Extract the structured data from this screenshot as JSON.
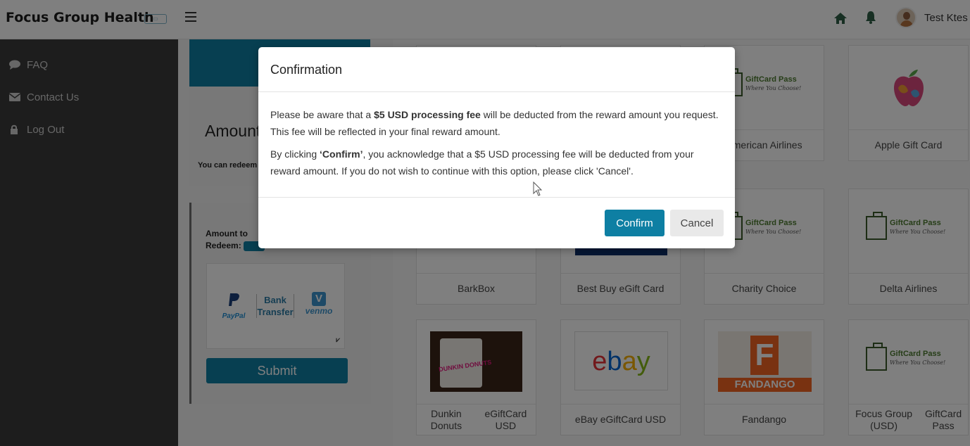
{
  "header": {
    "brand": "Focus Group Health",
    "user_name": "Test Ktes",
    "icons": [
      "menu-icon",
      "home-icon",
      "bell-icon",
      "avatar"
    ]
  },
  "sidebar": {
    "items": [
      {
        "label": "FAQ",
        "icon": "comment-icon"
      },
      {
        "label": "Contact Us",
        "icon": "envelope-icon"
      },
      {
        "label": "Log Out",
        "icon": "lock-icon"
      }
    ]
  },
  "amount": {
    "title": "Amount",
    "redeem_text": "You can redeem",
    "redeem_label_line1": "Amount to",
    "redeem_label_line2": "Redeem:",
    "payment_paypal": "PayPal",
    "payment_bank_line1": "Bank",
    "payment_bank_line2": "Transfer",
    "payment_venmo": "venmo",
    "submit_label": "Submit"
  },
  "gift_cards": [
    {
      "name": "American Airlines",
      "logo": "GiftCard Pass",
      "tagline": "Where You Choose!"
    },
    {
      "name": "Apple Gift Card",
      "logo": "apple-logo"
    },
    {
      "name": "BarkBox"
    },
    {
      "name": "Best Buy eGift Card"
    },
    {
      "name": "Charity Choice",
      "logo": "GiftCard Pass",
      "tagline": "Where You Choose!"
    },
    {
      "name": "Delta Airlines",
      "logo": "GiftCard Pass",
      "tagline": "Where You Choose!"
    },
    {
      "name_line1": "Dunkin Donuts",
      "name_line2": "eGiftCard USD",
      "logo": "DUNKIN DONUTS"
    },
    {
      "name": "eBay eGiftCard USD",
      "logo": "ebay"
    },
    {
      "name": "Fandango",
      "logo": "FANDANGO"
    },
    {
      "name_line1": "Focus Group (USD)",
      "name_line2": "GiftCard Pass",
      "logo": "GiftCard Pass",
      "tagline": "Where You Choose!"
    }
  ],
  "modal": {
    "title": "Confirmation",
    "para1_pre": "Please be aware that a ",
    "para1_bold": "$5 USD processing fee",
    "para1_post": " will be deducted from the reward amount you request. This fee will be reflected in your final reward amount.",
    "para2_pre": "By clicking ",
    "para2_bold": "‘Confirm’",
    "para2_post": ", you acknowledge that a $5 USD processing fee will be deducted from your reward amount. If you do not wish to continue with this option, please click 'Cancel'.",
    "confirm_label": "Confirm",
    "cancel_label": "Cancel"
  },
  "colors": {
    "accent": "#0e7fa3",
    "sidebar": "#3a3a3a",
    "overlay": "rgba(0,0,0,0.5)"
  }
}
